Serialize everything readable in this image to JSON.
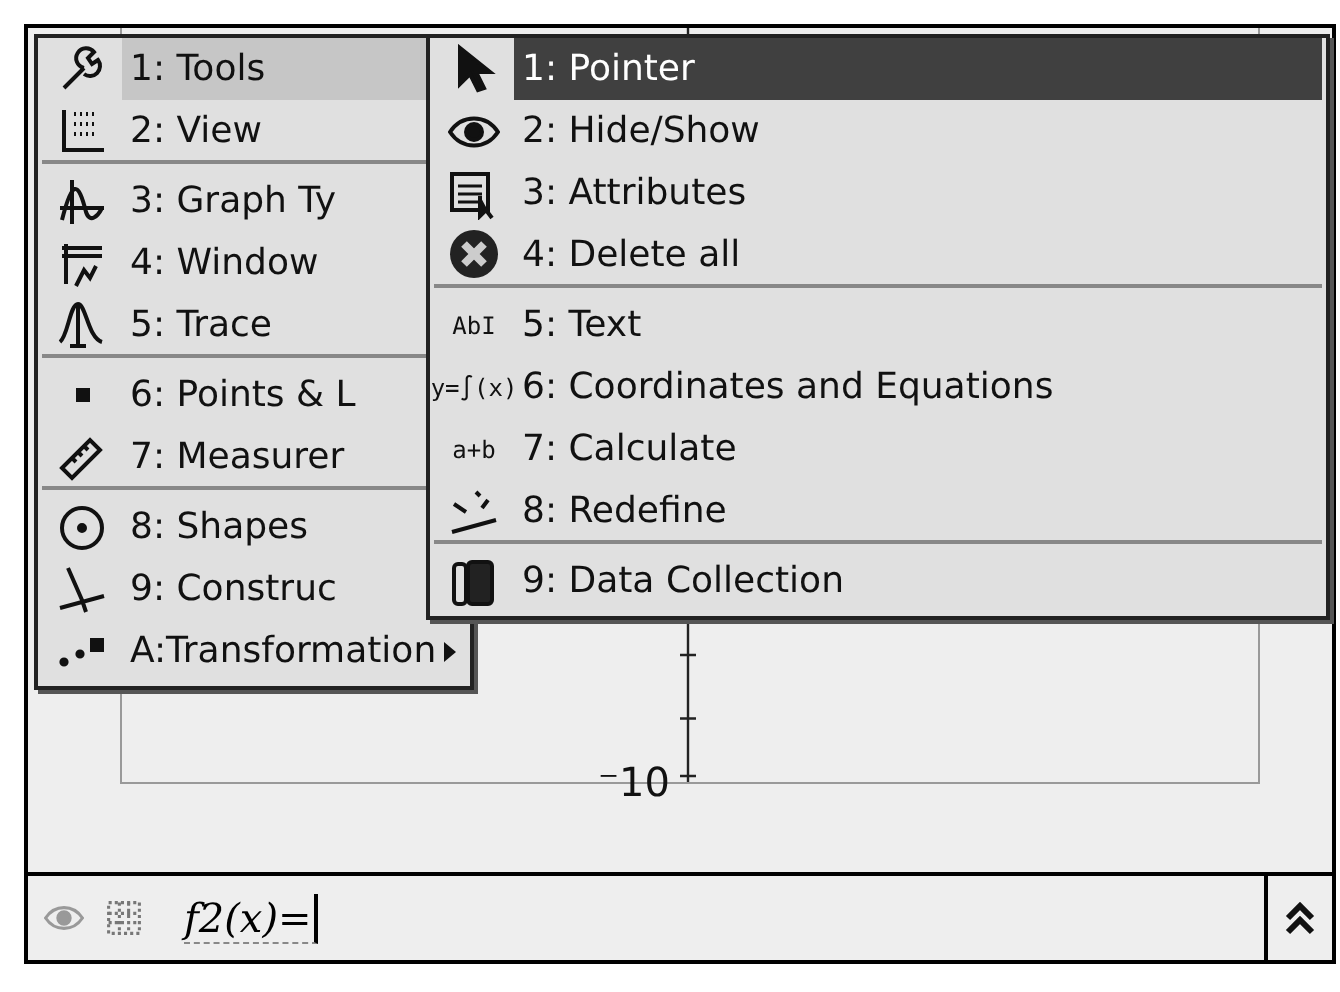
{
  "tools_menu": {
    "items": [
      {
        "label": "1: Tools",
        "selected": true,
        "separator_after": false
      },
      {
        "label": "2: View",
        "selected": false,
        "separator_after": true
      },
      {
        "label": "3: Graph Ty",
        "selected": false,
        "separator_after": false
      },
      {
        "label": "4: Window",
        "selected": false,
        "separator_after": false
      },
      {
        "label": "5: Trace",
        "selected": false,
        "separator_after": true
      },
      {
        "label": "6: Points & L",
        "selected": false,
        "separator_after": false
      },
      {
        "label": "7: Measurer",
        "selected": false,
        "separator_after": true
      },
      {
        "label": "8: Shapes",
        "selected": false,
        "separator_after": false
      },
      {
        "label": "9: Construc",
        "selected": false,
        "separator_after": false
      },
      {
        "label": "A:Transformation",
        "selected": false,
        "separator_after": false,
        "submenu": true
      }
    ]
  },
  "submenu": {
    "items": [
      {
        "label": "1: Pointer",
        "selected": true,
        "separator_after": false
      },
      {
        "label": "2: Hide/Show",
        "selected": false,
        "separator_after": false
      },
      {
        "label": "3: Attributes",
        "selected": false,
        "separator_after": false
      },
      {
        "label": "4: Delete all",
        "selected": false,
        "separator_after": true
      },
      {
        "label": "5: Text",
        "selected": false,
        "separator_after": false,
        "glyph": "AbI"
      },
      {
        "label": "6: Coordinates and Equations",
        "selected": false,
        "separator_after": false,
        "glyph": "y=∫(x)"
      },
      {
        "label": "7: Calculate",
        "selected": false,
        "separator_after": false,
        "glyph": "a+b"
      },
      {
        "label": "8: Redefine",
        "selected": false,
        "separator_after": true
      },
      {
        "label": "9: Data Collection",
        "selected": false,
        "separator_after": false
      }
    ]
  },
  "graph": {
    "axis_label": "⁻10"
  },
  "entry_line": {
    "value": "f2(x)="
  }
}
